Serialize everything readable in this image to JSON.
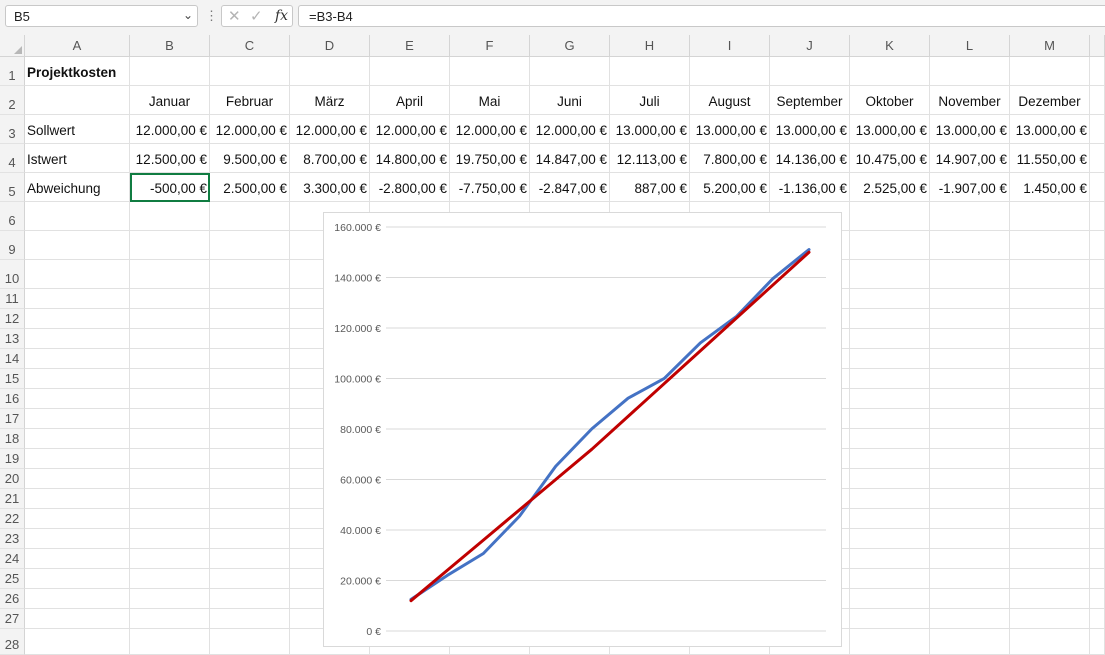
{
  "formula_bar": {
    "name_box": "B5",
    "formula": "=B3-B4",
    "fx_label": "fx"
  },
  "columns": [
    "A",
    "B",
    "C",
    "D",
    "E",
    "F",
    "G",
    "H",
    "I",
    "J",
    "K",
    "L",
    "M"
  ],
  "row_numbers": [
    "1",
    "2",
    "3",
    "4",
    "5",
    "6",
    "9",
    "10",
    "11",
    "12",
    "13",
    "14",
    "15",
    "16",
    "17",
    "18",
    "19",
    "20",
    "21",
    "22",
    "23",
    "24",
    "25",
    "26",
    "27",
    "28"
  ],
  "sheet": {
    "title": "Projektkosten",
    "months": [
      "Januar",
      "Februar",
      "März",
      "April",
      "Mai",
      "Juni",
      "Juli",
      "August",
      "September",
      "Oktober",
      "November",
      "Dezember"
    ],
    "rows": [
      {
        "label": "Sollwert",
        "values": [
          "12.000,00 €",
          "12.000,00 €",
          "12.000,00 €",
          "12.000,00 €",
          "12.000,00 €",
          "12.000,00 €",
          "13.000,00 €",
          "13.000,00 €",
          "13.000,00 €",
          "13.000,00 €",
          "13.000,00 €",
          "13.000,00 €"
        ]
      },
      {
        "label": "Istwert",
        "values": [
          "12.500,00 €",
          "9.500,00 €",
          "8.700,00 €",
          "14.800,00 €",
          "19.750,00 €",
          "14.847,00 €",
          "12.113,00 €",
          "7.800,00 €",
          "14.136,00 €",
          "10.475,00 €",
          "14.907,00 €",
          "11.550,00 €"
        ]
      },
      {
        "label": "Abweichung",
        "values": [
          "-500,00 €",
          "2.500,00 €",
          "3.300,00 €",
          "-2.800,00 €",
          "-7.750,00 €",
          "-2.847,00 €",
          "887,00 €",
          "5.200,00 €",
          "-1.136,00 €",
          "2.525,00 €",
          "-1.907,00 €",
          "1.450,00 €"
        ]
      }
    ]
  },
  "chart_data": {
    "type": "line",
    "y_tick_labels": [
      "160.000 €",
      "140.000 €",
      "120.000 €",
      "100.000 €",
      "80.000 €",
      "60.000 €",
      "40.000 €",
      "20.000 €",
      "0 €"
    ],
    "ylim": [
      0,
      160000
    ],
    "x": [
      1,
      2,
      3,
      4,
      5,
      6,
      7,
      8,
      9,
      10,
      11,
      12
    ],
    "series": [
      {
        "color": "#4472c4",
        "values": [
          12500,
          22000,
          30700,
          45500,
          65250,
          80097,
          92210,
          100010,
          114146,
          124621,
          139528,
          151078
        ]
      },
      {
        "color": "#c00000",
        "values": [
          12000,
          24000,
          36000,
          48000,
          60000,
          72000,
          85000,
          98000,
          111000,
          124000,
          137000,
          150000
        ]
      }
    ]
  }
}
